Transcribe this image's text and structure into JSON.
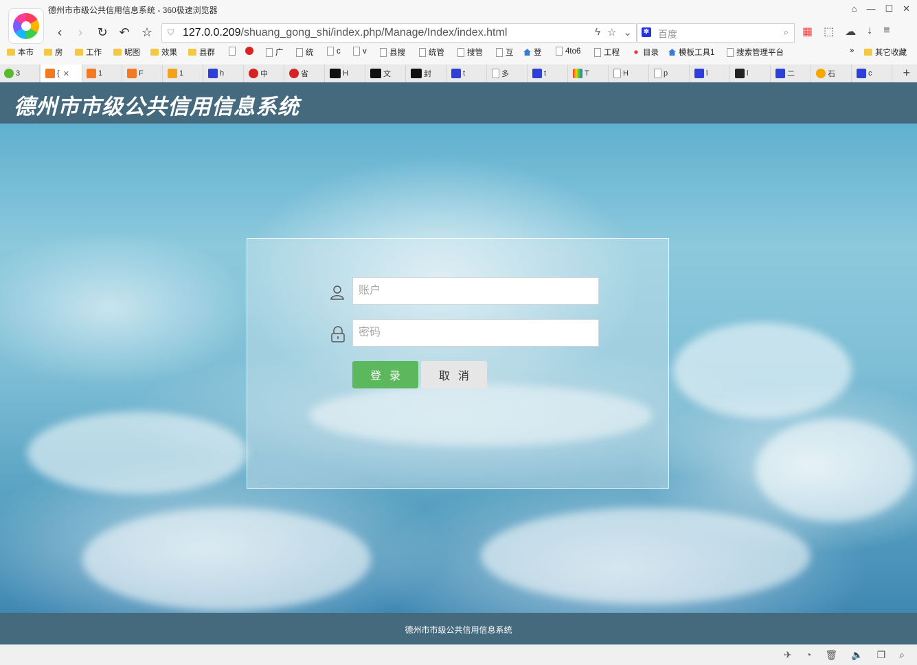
{
  "window": {
    "title": "德州市市级公共信用信息系统 - 360极速浏览器",
    "controls": [
      "⌂",
      "—",
      "☐",
      "✕"
    ]
  },
  "nav": {
    "back": "‹",
    "forward": "›",
    "reload": "↻",
    "undo": "↶",
    "star": "☆"
  },
  "address": {
    "host": "127.0.0.209",
    "path": "/shuang_gong_shi/index.php/Manage/Index/index.html",
    "actions": [
      "ϟ",
      "☆",
      "⌄"
    ]
  },
  "search": {
    "placeholder": "百度",
    "engine_icon": "baidu-paw-icon",
    "mag": "⌕"
  },
  "toolbar_right": [
    "▦",
    "⬚",
    "☁",
    "↓",
    "≡"
  ],
  "bookmarks": [
    {
      "label": "本市",
      "icon": "folder"
    },
    {
      "label": "房",
      "icon": "folder"
    },
    {
      "label": "工作",
      "icon": "folder"
    },
    {
      "label": "昵图",
      "icon": "folder"
    },
    {
      "label": "效果",
      "icon": "folder"
    },
    {
      "label": "县群",
      "icon": "folder"
    },
    {
      "label": "",
      "icon": "page"
    },
    {
      "label": "",
      "icon": "red"
    },
    {
      "label": "广",
      "icon": "page"
    },
    {
      "label": "统",
      "icon": "page"
    },
    {
      "label": "c",
      "icon": "page"
    },
    {
      "label": "v",
      "icon": "page"
    },
    {
      "label": "县搜",
      "icon": "page"
    },
    {
      "label": "统管",
      "icon": "page"
    },
    {
      "label": "搜管",
      "icon": "page"
    },
    {
      "label": "互",
      "icon": "page"
    },
    {
      "label": "登",
      "icon": "house"
    },
    {
      "label": "4to6",
      "icon": "page"
    },
    {
      "label": "工程",
      "icon": "page"
    },
    {
      "label": "目录",
      "icon": "dots"
    },
    {
      "label": "模板工具1",
      "icon": "house"
    },
    {
      "label": "搜索管理平台",
      "icon": "page"
    },
    {
      "label": "»",
      "icon": "none"
    },
    {
      "label": "其它收藏",
      "icon": "folder"
    }
  ],
  "tabs": [
    {
      "label": "3",
      "icon": "plus"
    },
    {
      "label": "{",
      "icon": "orange",
      "active": true
    },
    {
      "label": "1",
      "icon": "orange"
    },
    {
      "label": "F",
      "icon": "orange"
    },
    {
      "label": "1",
      "icon": "pma"
    },
    {
      "label": "h",
      "icon": "paw"
    },
    {
      "label": "中",
      "icon": "emblem"
    },
    {
      "label": "省",
      "icon": "emblem"
    },
    {
      "label": "H",
      "icon": "hui"
    },
    {
      "label": "文",
      "icon": "hui"
    },
    {
      "label": "封",
      "icon": "hui"
    },
    {
      "label": "t",
      "icon": "paw"
    },
    {
      "label": "多",
      "icon": "doc"
    },
    {
      "label": "t",
      "icon": "paw"
    },
    {
      "label": "T",
      "icon": "rainbow"
    },
    {
      "label": "H",
      "icon": "doc"
    },
    {
      "label": "p",
      "icon": "doc"
    },
    {
      "label": "l",
      "icon": "paw"
    },
    {
      "label": "l",
      "icon": "lab"
    },
    {
      "label": "二",
      "icon": "paw"
    },
    {
      "label": "石",
      "icon": "bolt"
    },
    {
      "label": "c",
      "icon": "paw"
    }
  ],
  "tab_add": "+",
  "tab_close": "✕",
  "page": {
    "title": "德州市市级公共信用信息系统",
    "account_placeholder": "账户",
    "password_placeholder": "密码",
    "login_label": "登录",
    "cancel_label": "取消",
    "footer": "德州市市级公共信用信息系统"
  },
  "colors": {
    "header_bg": "#466a7d",
    "login_green": "#5cb85c",
    "cancel_gray": "#e6e6e6"
  },
  "status_icons": [
    "✈",
    "◔",
    "🗑",
    "🔈",
    "❐",
    "⌕"
  ]
}
